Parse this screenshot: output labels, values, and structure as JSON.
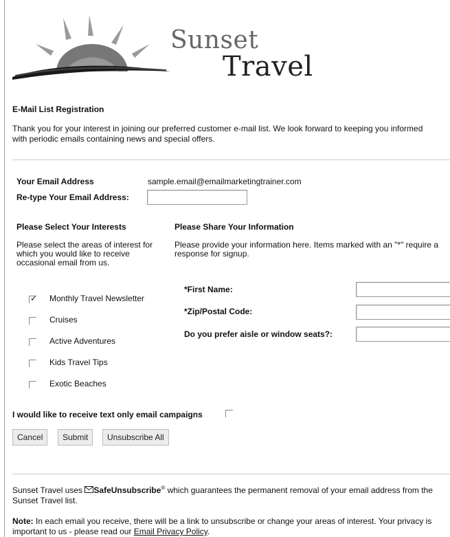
{
  "brand": {
    "line1": "Sunset",
    "line2": "Travel"
  },
  "page_title": "E-Mail List Registration",
  "intro": "Thank you for your interest in joining our preferred customer e-mail list. We look forward to keeping you informed with periodic emails containing news and special offers.",
  "email": {
    "label": "Your Email Address",
    "value": "sample.email@emailmarketingtrainer.com",
    "retype_label": "Re-type Your Email Address:",
    "retype_value": ""
  },
  "interests": {
    "heading": "Please Select Your Interests",
    "description": "Please select the areas of interest for which you would like to receive occasional email from us.",
    "items": [
      {
        "label": "Monthly Travel Newsletter",
        "checked": true
      },
      {
        "label": "Cruises",
        "checked": false
      },
      {
        "label": "Active Adventures",
        "checked": false
      },
      {
        "label": "Kids Travel Tips",
        "checked": false
      },
      {
        "label": "Exotic Beaches",
        "checked": false
      }
    ]
  },
  "info": {
    "heading": "Please Share Your Information",
    "description": "Please provide your information here. Items marked with an \"*\" require a response for signup.",
    "fields": [
      {
        "label": "*First Name:",
        "value": ""
      },
      {
        "label": "*Zip/Postal Code:",
        "value": ""
      },
      {
        "label": "Do you prefer aisle or window seats?:",
        "value": ""
      }
    ]
  },
  "text_only": {
    "label": "I would like to receive text only email campaigns",
    "checked": false
  },
  "buttons": {
    "cancel": "Cancel",
    "submit": "Submit",
    "unsubscribe": "Unsubscribe All"
  },
  "footer": {
    "safe_prefix": "Sunset Travel uses",
    "safe_brand": "SafeUnsubscribe",
    "safe_mark": "®",
    "safe_suffix": "which guarantees the permanent removal of your email address from the Sunset Travel list.",
    "note_label": "Note:",
    "note_text": "In each email you receive, there will be a link to unsubscribe or change your areas of interest. Your privacy is important to us - please read our",
    "policy_link": "Email Privacy Policy",
    "note_end": "."
  }
}
